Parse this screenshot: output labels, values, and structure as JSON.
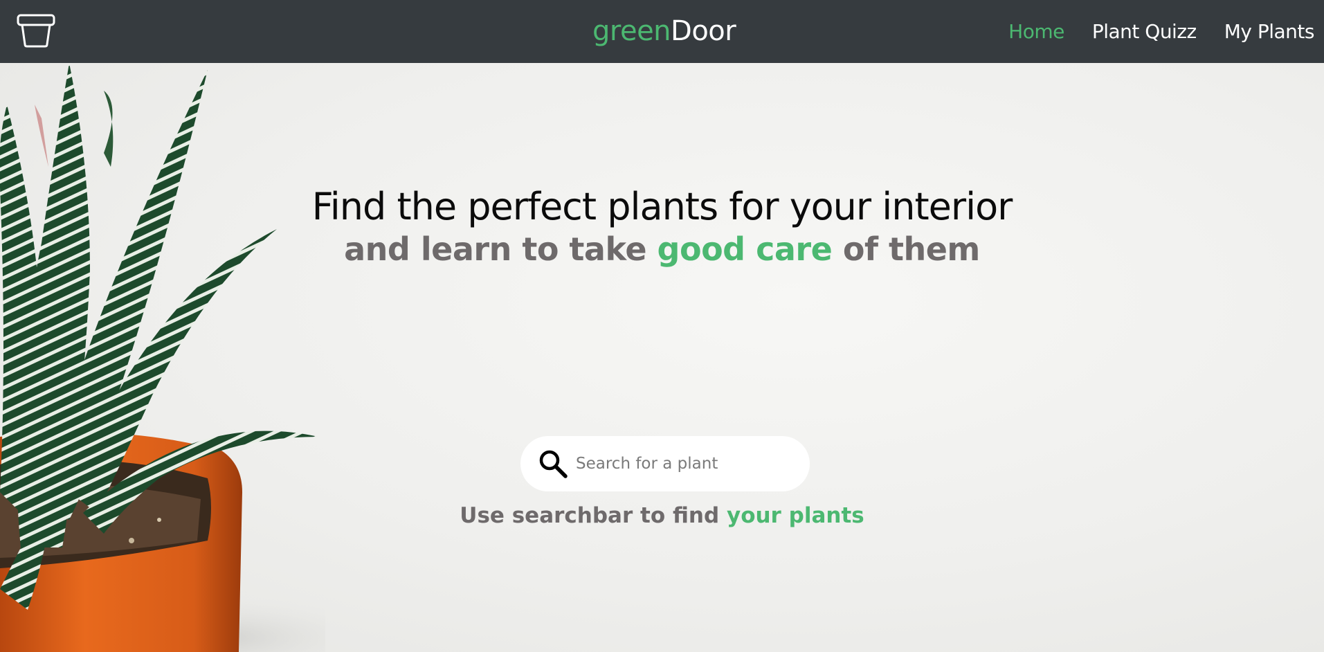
{
  "navbar": {
    "logo_icon": "plant-pot-icon",
    "brand": {
      "part1": "green",
      "part2": "Door"
    },
    "links": [
      {
        "label": "Home",
        "active": true
      },
      {
        "label": "Plant Quizz",
        "active": false
      },
      {
        "label": "My Plants",
        "active": false
      }
    ]
  },
  "hero": {
    "headline": "Find the perfect plants for your interior",
    "subline": {
      "pre": "and learn to take ",
      "highlight": "good care",
      "post": " of them"
    },
    "image": "potted-zebra-plant-image",
    "search": {
      "placeholder": "Search for a plant",
      "value": "",
      "icon": "search-icon"
    },
    "hint": {
      "pre": "Use searchbar to find ",
      "highlight": "your plants"
    }
  },
  "colors": {
    "accent_green": "#4cb871",
    "navbar_bg": "#363b3f",
    "subtext_gray": "#6e6a6b",
    "pot_orange": "#e0641c"
  }
}
